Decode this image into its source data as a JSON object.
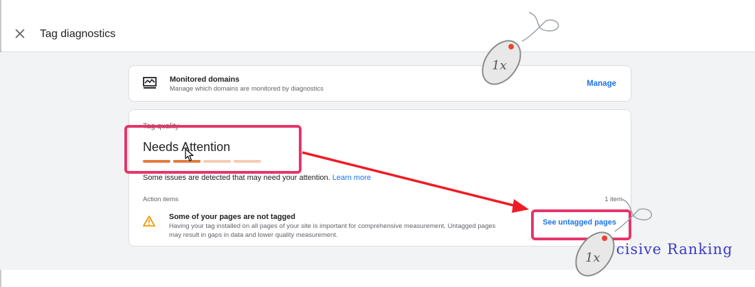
{
  "header": {
    "title": "Tag diagnostics"
  },
  "domains": {
    "title": "Monitored domains",
    "description": "Manage which domains are monitored by diagnostics",
    "action": "Manage"
  },
  "tag_quality": {
    "label": "Tag quality",
    "status": "Needs Attention",
    "level": {
      "filled": 2,
      "total": 4
    },
    "description": "Some issues are detected that may need your attention.",
    "learn_more": "Learn more",
    "action_items_label": "Action items",
    "item_count": "1 item",
    "issue": {
      "title": "Some of your pages are not tagged",
      "description": "Having your tag installed on all pages of your site is important for comprehensive measurement. Untagged pages may result in gaps in data and lower quality measurement.",
      "action": "See untagged pages"
    }
  },
  "overlay": {
    "mouse_badge": "1x",
    "watermark": "cisive Ranking"
  },
  "colors": {
    "accent": "#1a73e8",
    "bar_filled": "#e37a3d",
    "bar_empty": "#f6ccb1",
    "warning": "#f29900",
    "highlight": "#e5356a",
    "arrow": "#ee1c25"
  },
  "icons": {
    "close": "close-icon",
    "domains": "monitor-chart-icon",
    "warning": "warning-triangle-icon"
  }
}
